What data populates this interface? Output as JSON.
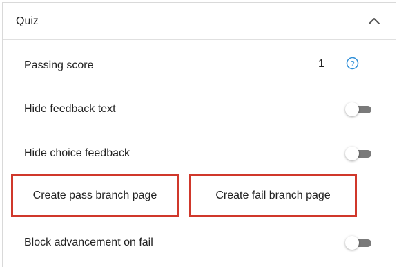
{
  "panel": {
    "title": "Quiz",
    "collapse_icon": "chevron-up-icon"
  },
  "passing_score": {
    "label": "Passing score",
    "value": "1",
    "help_icon": "question-circle-icon",
    "help_color": "#2f8fd8"
  },
  "hide_feedback_text": {
    "label": "Hide feedback text",
    "enabled": false
  },
  "hide_choice_feedback": {
    "label": "Hide choice feedback",
    "enabled": false
  },
  "branch_buttons": {
    "pass_label": "Create pass branch page",
    "fail_label": "Create fail branch page",
    "highlight_color": "#d0382b"
  },
  "block_advancement": {
    "label": "Block advancement on fail",
    "enabled": false
  }
}
